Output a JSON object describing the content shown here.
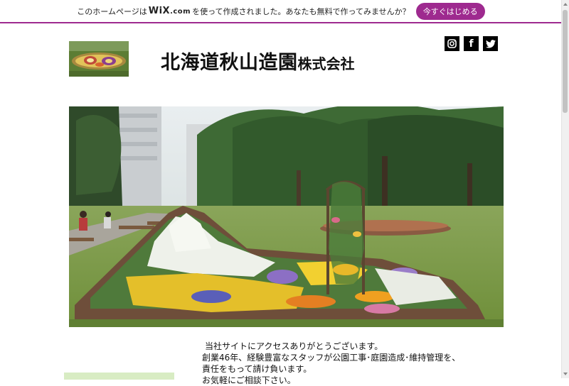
{
  "wix_banner": {
    "prefix": "このホームページは",
    "logo_text": "WiX",
    "logo_suffix": ".com",
    "suffix": "を使って作成されました。あなたも無料で作ってみませんか？",
    "cta_label": "今すぐはじめる"
  },
  "header": {
    "title_main": "北海道秋山造園",
    "title_sub": "株式会社"
  },
  "social": {
    "instagram_glyph": "◎",
    "facebook_glyph": "f",
    "twitter_glyph": "t"
  },
  "intro": {
    "line1": "当社サイトにアクセスありがとうございます。",
    "line2": "創業46年、経験豊富なスタッフが公園工事･庭園造成･維持管理を、",
    "line3": "責任をもって請け負います。",
    "line4": "お気軽にご相談下さい。"
  },
  "colors": {
    "brand": "#9e2a8f",
    "side_box": "#d8ecc3"
  }
}
